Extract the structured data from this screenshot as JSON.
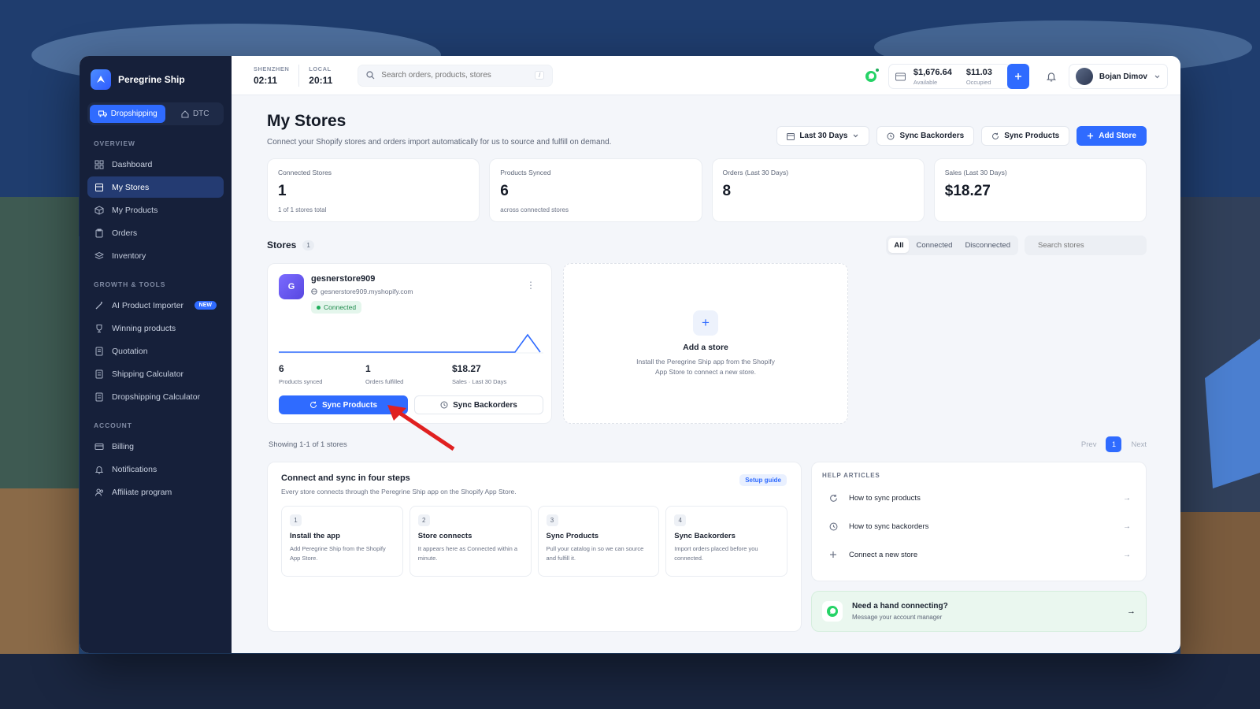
{
  "app": {
    "name": "Peregrine Ship"
  },
  "mode_switch": {
    "dropshipping": "Dropshipping",
    "dtc": "DTC"
  },
  "sidebar": {
    "sections": [
      {
        "label": "OVERVIEW",
        "items": [
          {
            "label": "Dashboard",
            "icon": "grid-icon"
          },
          {
            "label": "My Stores",
            "icon": "store-icon",
            "active": true
          },
          {
            "label": "My Products",
            "icon": "box-icon"
          },
          {
            "label": "Orders",
            "icon": "clipboard-icon"
          },
          {
            "label": "Inventory",
            "icon": "layers-icon"
          }
        ]
      },
      {
        "label": "GROWTH & TOOLS",
        "items": [
          {
            "label": "AI Product Importer",
            "icon": "wand-icon",
            "badge": "NEW"
          },
          {
            "label": "Winning products",
            "icon": "trophy-icon"
          },
          {
            "label": "Quotation",
            "icon": "document-icon"
          },
          {
            "label": "Shipping Calculator",
            "icon": "calculator-icon"
          },
          {
            "label": "Dropshipping Calculator",
            "icon": "calculator-icon"
          }
        ]
      },
      {
        "label": "ACCOUNT",
        "items": [
          {
            "label": "Billing",
            "icon": "card-icon"
          },
          {
            "label": "Notifications",
            "icon": "bell-icon"
          },
          {
            "label": "Affiliate program",
            "icon": "users-icon"
          }
        ]
      }
    ]
  },
  "topbar": {
    "clock1": {
      "label": "SHENZHEN",
      "time": "02:11"
    },
    "clock2": {
      "label": "LOCAL",
      "time": "20:11"
    },
    "search_placeholder": "Search orders, products, stores",
    "search_kbd": "/",
    "balance_available": "$1,676.64",
    "balance_available_label": "Available",
    "balance_occupied": "$11.03",
    "balance_occupied_label": "Occupied",
    "user_name": "Bojan Dimov"
  },
  "page": {
    "title": "My Stores",
    "subtitle": "Connect your Shopify stores and orders import automatically for us to source and fulfill on demand.",
    "actions": {
      "range": "Last 30 Days",
      "sync_backorders": "Sync Backorders",
      "sync_products": "Sync Products",
      "add_store": "Add Store"
    }
  },
  "stats": [
    {
      "label": "Connected Stores",
      "value": "1",
      "sub": "1 of 1 stores total"
    },
    {
      "label": "Products Synced",
      "value": "6",
      "sub": "across connected stores"
    },
    {
      "label": "Orders (Last 30 Days)",
      "value": "8",
      "sub": ""
    },
    {
      "label": "Sales (Last 30 Days)",
      "value": "$18.27",
      "sub": ""
    }
  ],
  "stores": {
    "title": "Stores",
    "count": "1",
    "filters": {
      "all": "All",
      "connected": "Connected",
      "disconnected": "Disconnected"
    },
    "search_placeholder": "Search stores",
    "store": {
      "initial": "G",
      "name": "gesnerstore909",
      "url": "gesnerstore909.myshopify.com",
      "status": "Connected",
      "metrics": [
        {
          "value": "6",
          "label": "Products synced"
        },
        {
          "value": "1",
          "label": "Orders fulfilled"
        },
        {
          "value": "$18.27",
          "label": "Sales · Last 30 Days"
        }
      ],
      "sync_products": "Sync Products",
      "sync_backorders": "Sync Backorders"
    },
    "add": {
      "title": "Add a store",
      "desc": "Install the Peregrine Ship app from the Shopify App Store to connect a new store."
    },
    "showing": "Showing 1-1 of 1 stores",
    "pager": {
      "prev": "Prev",
      "page": "1",
      "next": "Next"
    }
  },
  "steps_card": {
    "title": "Connect and sync in four steps",
    "subtitle": "Every store connects through the Peregrine Ship app on the Shopify App Store.",
    "guide": "Setup guide",
    "steps": [
      {
        "num": "1",
        "title": "Install the app",
        "desc": "Add Peregrine Ship from the Shopify App Store."
      },
      {
        "num": "2",
        "title": "Store connects",
        "desc": "It appears here as Connected within a minute."
      },
      {
        "num": "3",
        "title": "Sync Products",
        "desc": "Pull your catalog in so we can source and fulfill it."
      },
      {
        "num": "4",
        "title": "Sync Backorders",
        "desc": "Import orders placed before you connected."
      }
    ]
  },
  "help": {
    "label": "HELP ARTICLES",
    "items": [
      {
        "label": "How to sync products"
      },
      {
        "label": "How to sync backorders"
      },
      {
        "label": "Connect a new store"
      }
    ]
  },
  "contact": {
    "title": "Need a hand connecting?",
    "sub": "Message your account manager"
  },
  "colors": {
    "accent": "#2f6bff",
    "sidebar": "#16203a",
    "success": "#1fae5b"
  }
}
